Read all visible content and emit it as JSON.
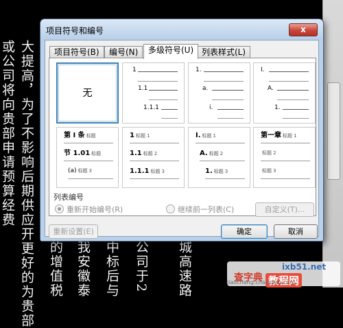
{
  "background": {
    "columns": [
      "或公司将向贵部申请预算经费",
      "大提高，为了不影响后期供应开更好的为贵部"
    ],
    "bottom_columns": [
      "的增值税",
      "我安徽泰",
      "中标后与",
      "公司于2",
      "城高速路"
    ]
  },
  "watermark": {
    "site": "ixb51.net",
    "main": "查字典",
    "sub": "教程网",
    "url": "jiaocheng.chazidian.com"
  },
  "dialog": {
    "title": "项目符号和编号",
    "close": "x",
    "tabs": [
      "项目符号(B)",
      "编号(N)",
      "多级符号(U)",
      "列表样式(L)"
    ],
    "active_tab": 2,
    "grid": {
      "none_label": "无",
      "cell2": [
        "1",
        "1.1",
        "1.1.1"
      ],
      "cell3": [
        "1.",
        "a.",
        "i."
      ],
      "cell4": [
        "I.",
        "A.",
        "1."
      ],
      "cell5": [
        "第 I 条",
        "节 1.01",
        "(a)"
      ],
      "cell6": [
        "1",
        "1.1",
        "1.1.1"
      ],
      "cell7": [
        "I.",
        "A.",
        "1."
      ],
      "cell8": [
        "第一章"
      ],
      "heading_word": "标题",
      "heading_nums": [
        "1",
        "2",
        "3"
      ]
    },
    "list_numbering_label": "列表编号",
    "options": {
      "restart": "重新开始编号(R)",
      "continue": "继续前一列表(C)",
      "customize": "自定义(T)..."
    },
    "buttons": {
      "reset": "重新设置(E)",
      "ok": "确定",
      "cancel": "取消"
    }
  }
}
